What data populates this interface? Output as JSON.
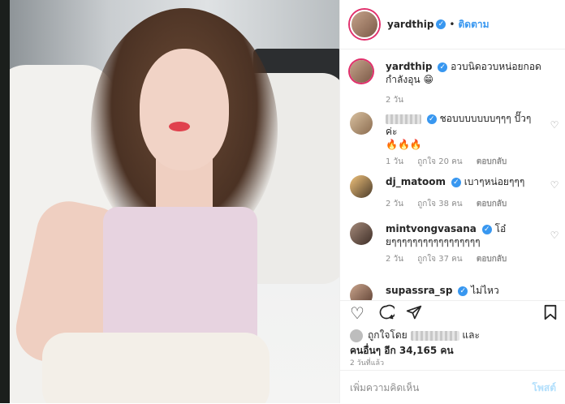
{
  "post": {
    "username": "yardthip",
    "follow_label": "ติดตาม",
    "dot": "•",
    "caption": "อวบนิดอวบหน่อยกอดกำลังอุน",
    "caption_emoji": "😁",
    "caption_time": "2 วัน"
  },
  "comments": [
    {
      "username": "",
      "text": "ชอบบบบบบบๆๆๆ ปั๊วๆค่ะ",
      "emoji": "🔥🔥🔥",
      "time": "1 วัน",
      "likes": "ถูกใจ 20 คน",
      "reply": "ตอบกลับ"
    },
    {
      "username": "dj_matoom",
      "text": "เบาๆหน่อยๆๆๆ",
      "time": "2 วัน",
      "likes": "ถูกใจ 38 คน",
      "reply": "ตอบกลับ"
    },
    {
      "username": "mintvongvasana",
      "text": "โอ๋ ยๆๆๆๆๆๆๆๆๆๆๆๆๆๆๆๆๆ",
      "time": "2 วัน",
      "likes": "ถูกใจ 37 คน",
      "reply": "ตอบกลับ"
    },
    {
      "username": "supassra_sp",
      "text": "ไม่ไหววววววววววว"
    }
  ],
  "liked_by": {
    "prefix": "ถูกใจโดย",
    "and": "และ",
    "others": "คนอื่นๆ อีก 34,165 คน"
  },
  "post_time": "2 วันที่แล้ว",
  "add_comment": {
    "placeholder": "เพิ่มความคิดเห็น",
    "post_label": "โพสต์"
  },
  "icons": {
    "heart": "heart-icon",
    "comment": "comment-icon",
    "share": "share-icon",
    "bookmark": "bookmark-icon"
  },
  "colors": {
    "accent": "#3897f0",
    "muted": "#8e8e8e",
    "story_ring": "#e1306c"
  }
}
